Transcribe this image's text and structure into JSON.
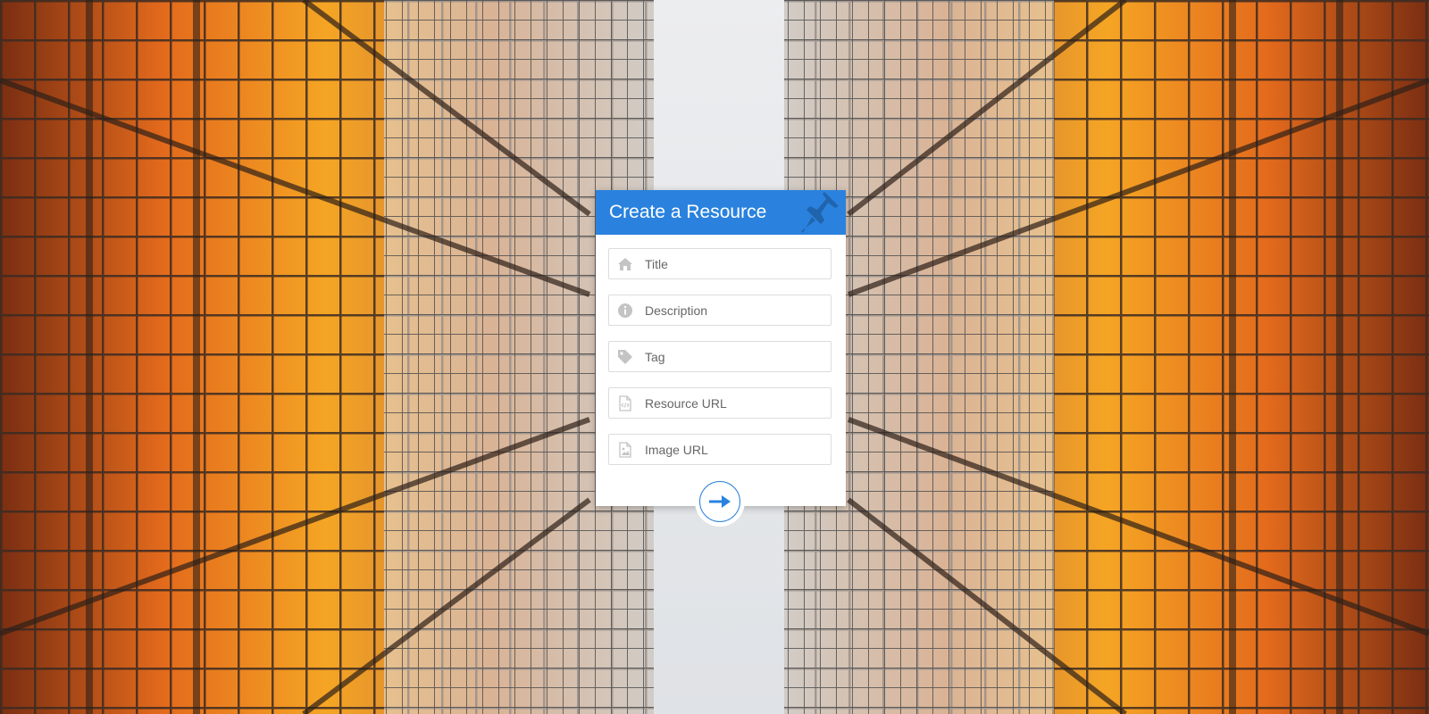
{
  "form": {
    "title": "Create a Resource",
    "header_icon": "pushpin-icon",
    "fields": [
      {
        "placeholder": "Title",
        "icon": "home-icon"
      },
      {
        "placeholder": "Description",
        "icon": "info-icon"
      },
      {
        "placeholder": "Tag",
        "icon": "tag-icon"
      },
      {
        "placeholder": "Resource URL",
        "icon": "code-file-icon"
      },
      {
        "placeholder": "Image URL",
        "icon": "image-file-icon"
      }
    ],
    "submit_icon": "arrow-right-icon"
  },
  "colors": {
    "accent": "#2a82de",
    "card_bg": "#ffffff",
    "field_border": "#dcdcdc",
    "icon_gray": "#c4c4c4"
  }
}
